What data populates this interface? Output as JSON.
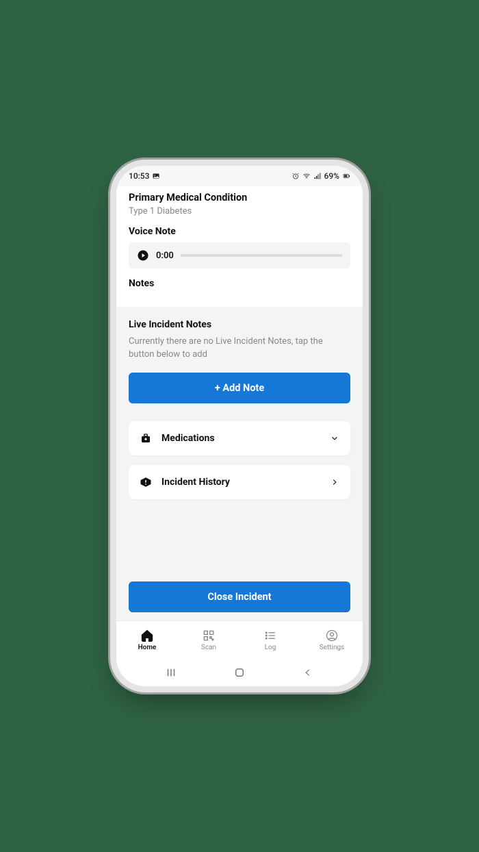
{
  "status": {
    "time": "10:53",
    "battery": "69%"
  },
  "primary": {
    "title": "Primary Medical Condition",
    "value": "Type 1 Diabetes"
  },
  "voice": {
    "title": "Voice Note",
    "time": "0:00"
  },
  "notes": {
    "title": "Notes"
  },
  "live": {
    "title": "Live Incident Notes",
    "empty": "Currently there are no Live Incident Notes, tap the button below to add",
    "add_label": "+ Add Note"
  },
  "rows": {
    "medications": "Medications",
    "history": "Incident History"
  },
  "close_label": "Close Incident",
  "tabs": {
    "home": "Home",
    "scan": "Scan",
    "log": "Log",
    "settings": "Settings"
  },
  "colors": {
    "primary": "#1577d6"
  }
}
